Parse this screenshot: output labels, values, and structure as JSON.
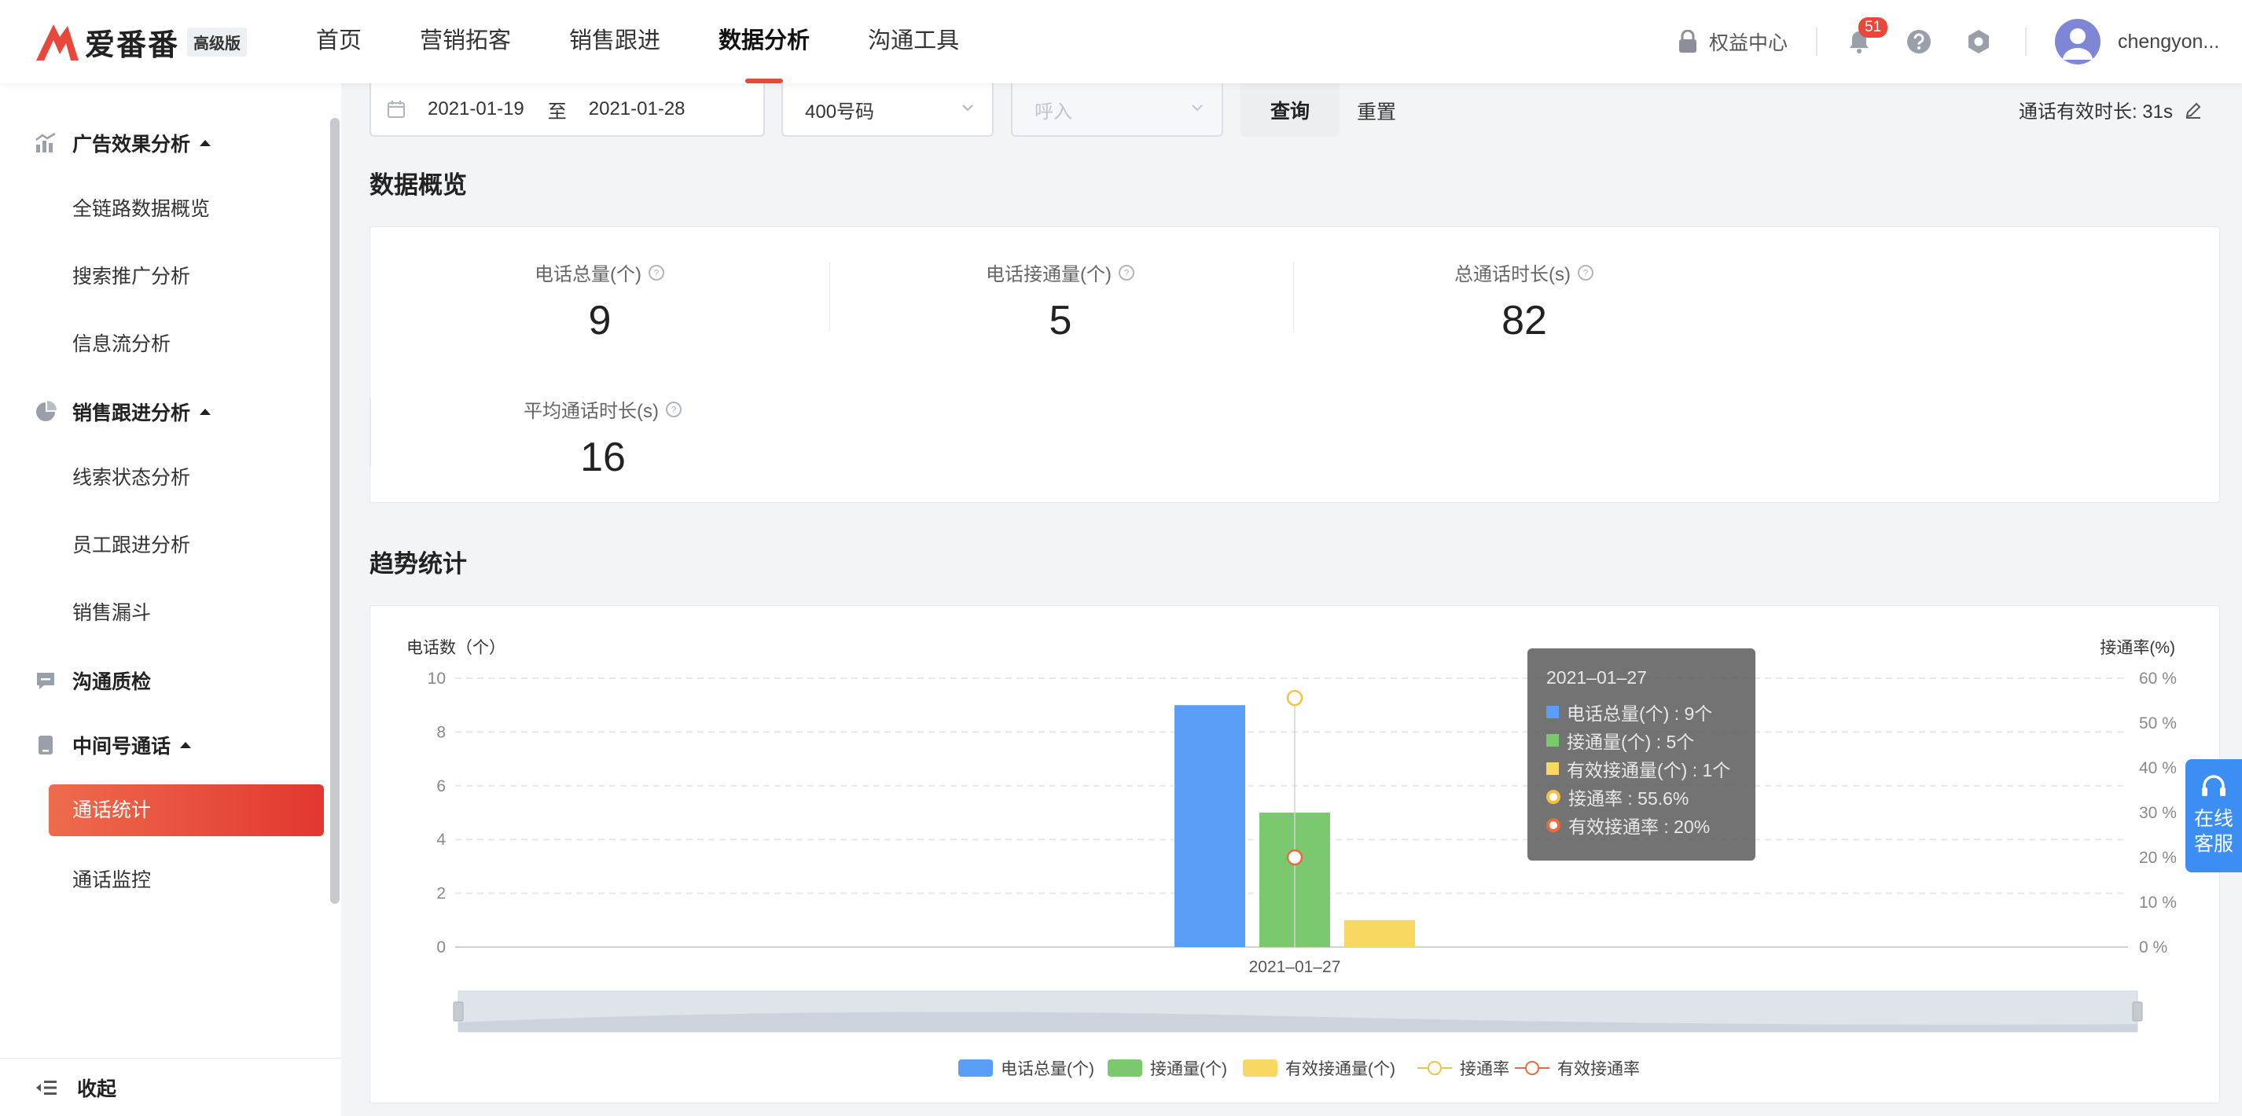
{
  "header": {
    "logo_text": "爱番番",
    "logo_badge": "高级版",
    "nav": [
      "首页",
      "营销拓客",
      "销售跟进",
      "数据分析",
      "沟通工具"
    ],
    "active_nav": 3,
    "rights_label": "权益中心",
    "notification_count": "51",
    "username": "chengyon..."
  },
  "sidebar": {
    "groups": [
      {
        "label": "广告效果分析",
        "icon": "bar-chart-icon",
        "items": [
          "全链路数据概览",
          "搜索推广分析",
          "信息流分析"
        ]
      },
      {
        "label": "销售跟进分析",
        "icon": "pie-chart-icon",
        "items": [
          "线索状态分析",
          "员工跟进分析",
          "销售漏斗"
        ]
      },
      {
        "label": "沟通质检",
        "icon": "message-icon",
        "items": []
      },
      {
        "label": "中间号通话",
        "icon": "phone-icon",
        "items": [
          "通话统计",
          "通话监控"
        ]
      }
    ],
    "active_item": "通话统计",
    "collapse_label": "收起"
  },
  "filter": {
    "start_date": "2021-01-19",
    "date_sep": "至",
    "end_date": "2021-01-28",
    "number_type": "400号码",
    "direction_placeholder": "呼入",
    "query_label": "查询",
    "reset_label": "重置",
    "valid_duration_label": "通话有效时长: 31s"
  },
  "overview": {
    "title": "数据概览",
    "stats": [
      {
        "label": "电话总量(个)",
        "value": "9"
      },
      {
        "label": "电话接通量(个)",
        "value": "5"
      },
      {
        "label": "总通话时长(s)",
        "value": "82"
      },
      {
        "label": "平均通话时长(s)",
        "value": "16"
      }
    ]
  },
  "trend": {
    "title": "趋势统计"
  },
  "chart_data": {
    "type": "bar",
    "categories": [
      "2021–01–27"
    ],
    "series": [
      {
        "name": "电话总量(个)",
        "kind": "bar",
        "axis": "left",
        "color": "#5a9ef8",
        "values": [
          9
        ]
      },
      {
        "name": "接通量(个)",
        "kind": "bar",
        "axis": "left",
        "color": "#7cc86e",
        "values": [
          5
        ]
      },
      {
        "name": "有效接通量(个)",
        "kind": "bar",
        "axis": "left",
        "color": "#f8d862",
        "values": [
          1
        ]
      },
      {
        "name": "接通率",
        "kind": "line",
        "axis": "right",
        "color": "#f6c143",
        "values": [
          55.6
        ]
      },
      {
        "name": "有效接通率",
        "kind": "line",
        "axis": "right",
        "color": "#ea6b3a",
        "values": [
          20
        ]
      }
    ],
    "ylabel": "电话数（个）",
    "ylabel_right": "接通率(%)",
    "ylim": [
      0,
      10
    ],
    "yticks": [
      0,
      2,
      4,
      6,
      8,
      10
    ],
    "ylim_right": [
      0,
      60
    ],
    "yticks_right": [
      "0 %",
      "10 %",
      "20 %",
      "30 %",
      "40 %",
      "50 %",
      "60 %"
    ],
    "grid": true,
    "legend": "bottom-center",
    "tooltip": {
      "date": "2021–01–27",
      "rows": [
        "电话总量(个) : 9个",
        "接通量(个) : 5个",
        "有效接通量(个) : 1个",
        "接通率 : 55.6%",
        "有效接通率 : 20%"
      ]
    }
  },
  "float_service": {
    "line1": "在线",
    "line2": "客服"
  }
}
